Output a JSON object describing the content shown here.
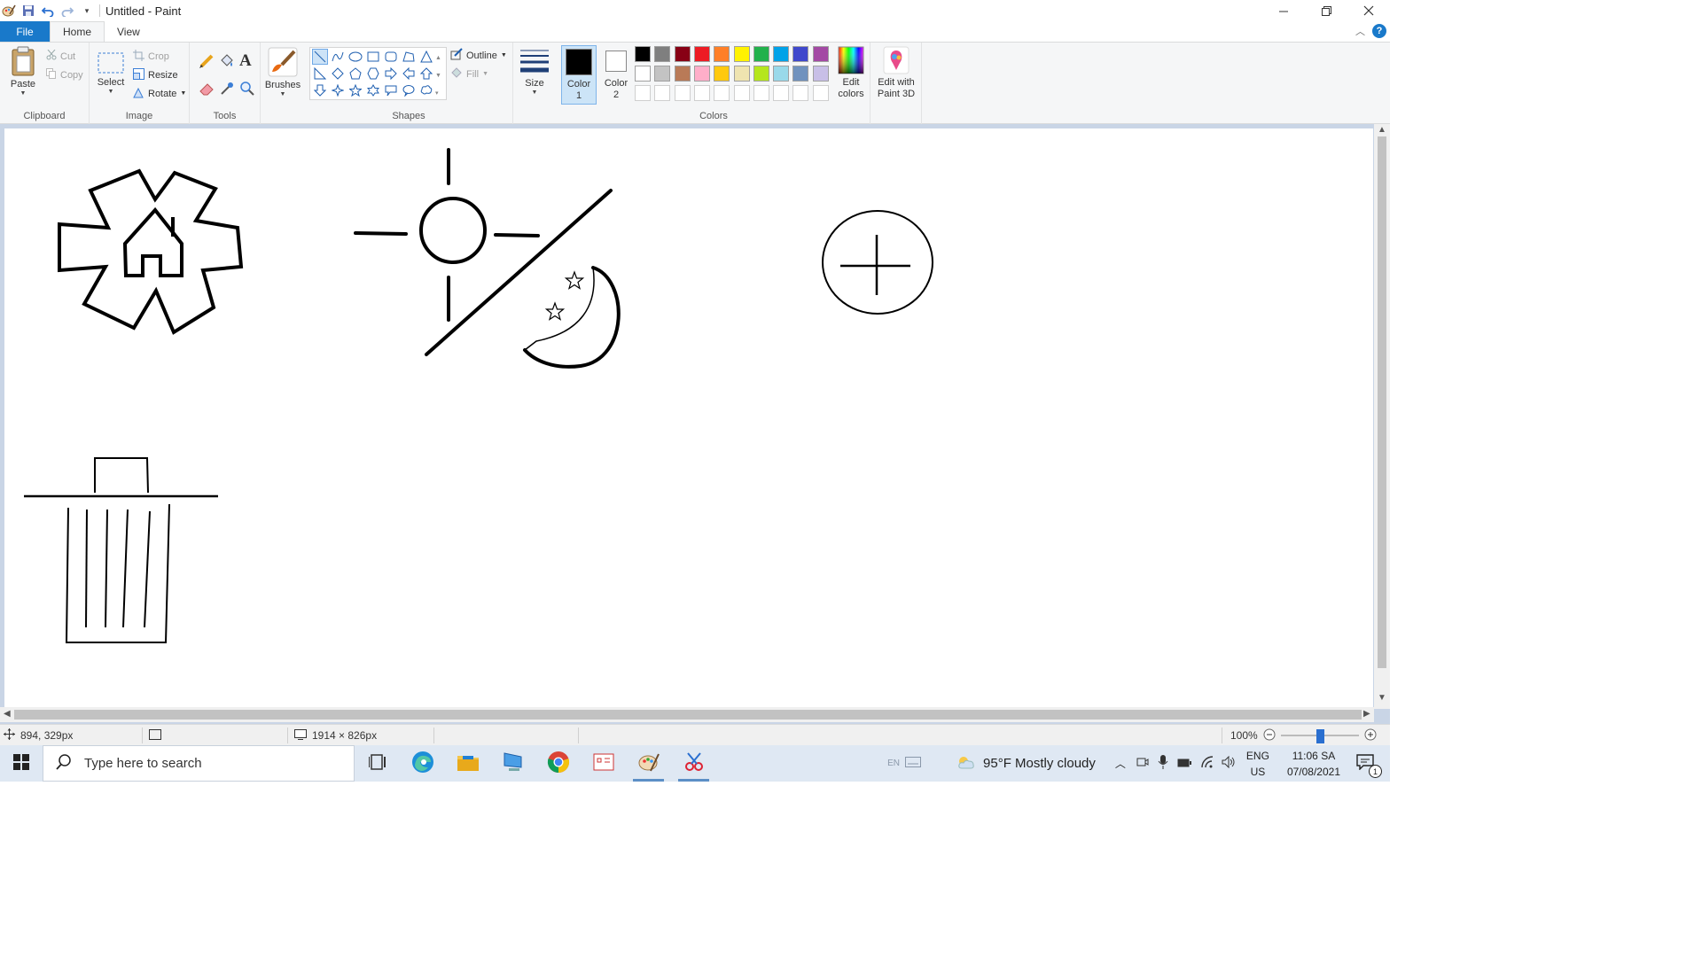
{
  "window": {
    "title": "Untitled - Paint",
    "controls": [
      "minimize",
      "restore",
      "close"
    ]
  },
  "tabs": [
    {
      "label": "File"
    },
    {
      "label": "Home"
    },
    {
      "label": "View"
    }
  ],
  "ribbon": {
    "clipboard": {
      "paste": "Paste",
      "cut": "Cut",
      "copy": "Copy",
      "group": "Clipboard"
    },
    "image": {
      "select": "Select",
      "crop": "Crop",
      "resize": "Resize",
      "rotate": "Rotate",
      "group": "Image"
    },
    "tools": {
      "group": "Tools"
    },
    "brushes": {
      "label": "Brushes"
    },
    "shapes": {
      "outline": "Outline",
      "fill": "Fill",
      "group": "Shapes"
    },
    "size": {
      "label": "Size"
    },
    "colors": {
      "color1": "Color",
      "color1_num": "1",
      "color2": "Color",
      "color2_num": "2",
      "edit_colors_1": "Edit",
      "edit_colors_2": "colors",
      "group": "Colors",
      "color1_value": "#000000",
      "color2_value": "#ffffff",
      "palette_row1": [
        "#000000",
        "#7f7f7f",
        "#880015",
        "#ed1c24",
        "#ff7f27",
        "#fff200",
        "#22b14c",
        "#00a2e8",
        "#3f48cc",
        "#a349a4"
      ],
      "palette_row2": [
        "#ffffff",
        "#c3c3c3",
        "#b97a57",
        "#ffaec9",
        "#ffc90e",
        "#efe4b0",
        "#b5e61d",
        "#99d9ea",
        "#7092be",
        "#c8bfe7"
      ],
      "palette_row3": [
        "#ffffff",
        "#ffffff",
        "#ffffff",
        "#ffffff",
        "#ffffff",
        "#ffffff",
        "#ffffff",
        "#ffffff",
        "#ffffff",
        "#ffffff"
      ]
    },
    "paint3d": {
      "line1": "Edit with",
      "line2": "Paint 3D"
    }
  },
  "status": {
    "cursor_pos": "894, 329px",
    "canvas_size": "1914 × 826px",
    "zoom": "100%",
    "zoom_level_percent": 100
  },
  "taskbar": {
    "search_placeholder": "Type here to search",
    "weather": "95°F  Mostly cloudy",
    "lang_1": "ENG",
    "lang_2": "US",
    "time": "11:06 SA",
    "date": "07/08/2021",
    "notifications": "1",
    "ime": "EN"
  }
}
